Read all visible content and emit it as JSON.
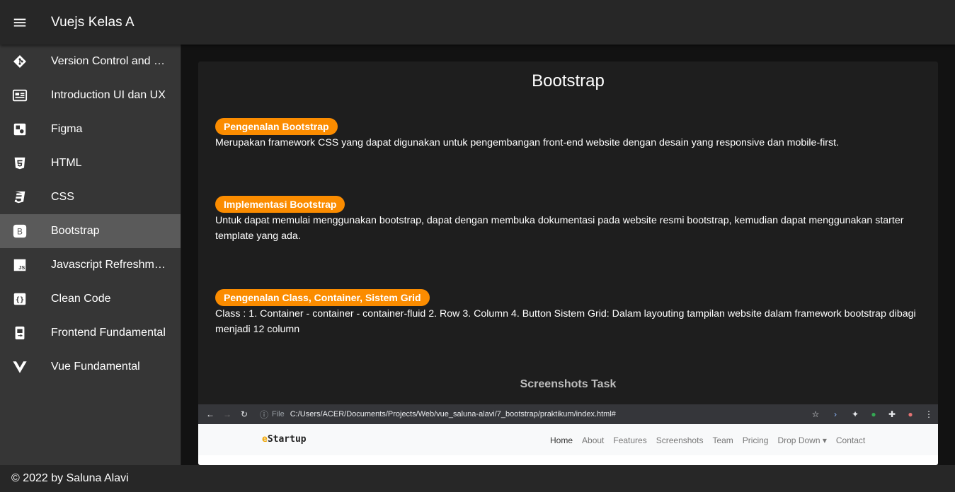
{
  "appbar": {
    "title": "Vuejs Kelas A",
    "menu_icon": "menu-icon"
  },
  "sidebar": {
    "items": [
      {
        "label": "Version Control and B...",
        "icon": "git-icon",
        "active": false
      },
      {
        "label": "Introduction UI dan UX",
        "icon": "card-text-icon",
        "active": false
      },
      {
        "label": "Figma",
        "icon": "figma-icon",
        "active": false
      },
      {
        "label": "HTML",
        "icon": "html5-icon",
        "active": false
      },
      {
        "label": "CSS",
        "icon": "css3-icon",
        "active": false
      },
      {
        "label": "Bootstrap",
        "icon": "bootstrap-icon",
        "active": true
      },
      {
        "label": "Javascript Refreshme...",
        "icon": "js-icon",
        "active": false
      },
      {
        "label": "Clean Code",
        "icon": "code-braces-icon",
        "active": false
      },
      {
        "label": "Frontend Fundamental",
        "icon": "cellphone-icon",
        "active": false
      },
      {
        "label": "Vue Fundamental",
        "icon": "vuejs-icon",
        "active": false
      }
    ]
  },
  "main": {
    "title": "Bootstrap",
    "sections": [
      {
        "badge": "Pengenalan Bootstrap",
        "text": "Merupakan framework CSS yang dapat digunakan untuk pengembangan front-end website dengan desain yang responsive dan mobile-first."
      },
      {
        "badge": "Implementasi Bootstrap",
        "text": "Untuk dapat memulai menggunakan bootstrap, dapat dengan membuka dokumentasi pada website resmi bootstrap, kemudian dapat menggunakan starter template yang ada."
      },
      {
        "badge": "Pengenalan Class, Container, Sistem Grid",
        "text": "Class : 1. Container - container - container-fluid 2. Row 3. Column 4. Button Sistem Grid: Dalam layouting tampilan website dalam framework bootstrap dibagi menjadi 12 column"
      }
    ],
    "screenshots_title": "Screenshots Task",
    "screenshot": {
      "url_prefix": "File",
      "url": "C:/Users/ACER/Documents/Projects/Web/vue_saluna-alavi/7_bootstrap/praktikum/index.html#",
      "brand_first": "e",
      "brand_rest": "Startup",
      "nav_links": [
        "Home",
        "About",
        "Features",
        "Screenshots",
        "Team",
        "Pricing",
        "Drop Down ▾",
        "Contact"
      ]
    },
    "badge_color": "#fb8c00"
  },
  "footer": {
    "text": "© 2022 by Saluna Alavi"
  }
}
